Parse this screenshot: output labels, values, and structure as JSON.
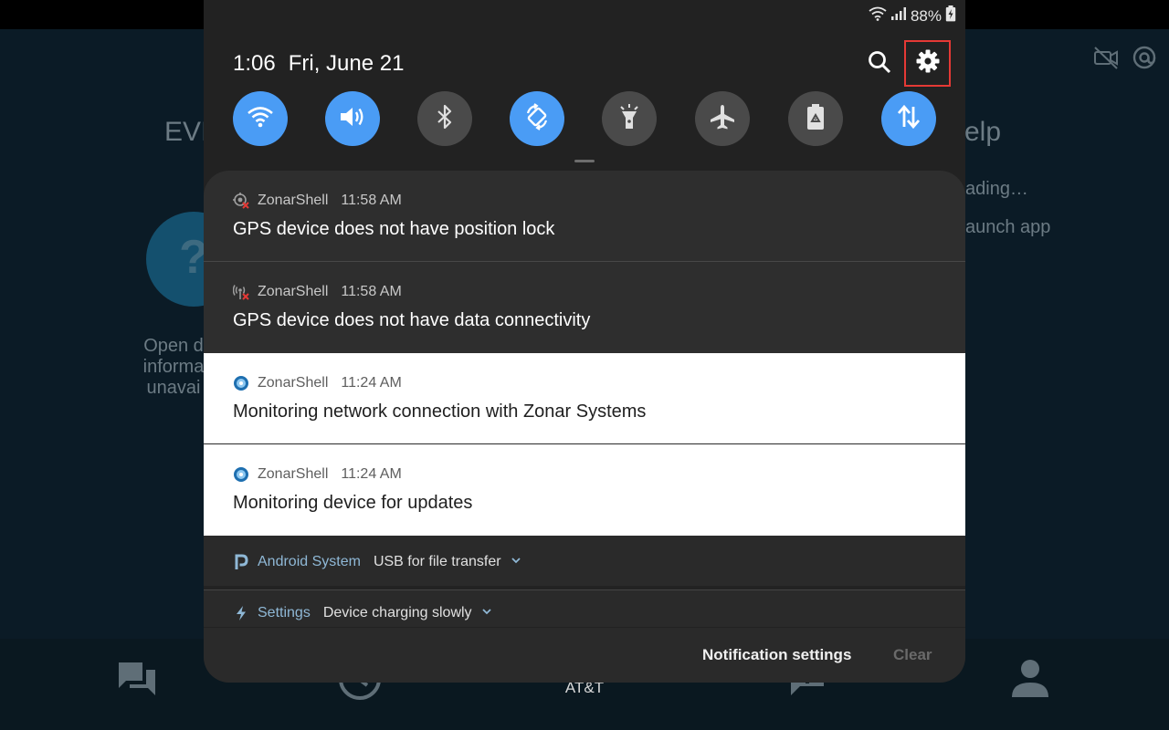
{
  "background_app": {
    "left_title": "EVI",
    "right_title": "elp",
    "right_line1": "ading…",
    "right_line2": "aunch app",
    "left_text": "Open d informa unavai",
    "help_glyph": "?",
    "carrier": "AT&T",
    "top_icons": [
      "camera-off-icon",
      "at-sign-icon"
    ],
    "nav_icons": [
      "chat-icon",
      "clock-icon",
      "alert-icon",
      "person-icon"
    ]
  },
  "status_bar": {
    "battery": "88%",
    "icons": [
      "wifi-icon",
      "signal-icon",
      "battery-charging-icon"
    ]
  },
  "header": {
    "time": "1:06",
    "date": "Fri, June 21"
  },
  "quick_settings": [
    {
      "name": "wifi",
      "on": true
    },
    {
      "name": "sound",
      "on": true
    },
    {
      "name": "bluetooth",
      "on": false
    },
    {
      "name": "auto-rotate",
      "on": true
    },
    {
      "name": "flashlight",
      "on": false
    },
    {
      "name": "airplane-mode",
      "on": false
    },
    {
      "name": "power-saving",
      "on": false
    },
    {
      "name": "mobile-data",
      "on": true
    }
  ],
  "notifications": [
    {
      "app": "ZonarShell",
      "time": "11:58 AM",
      "message": "GPS device does not have position lock",
      "icon": "gps-error-icon",
      "theme": "dark"
    },
    {
      "app": "ZonarShell",
      "time": "11:58 AM",
      "message": "GPS device does not have data connectivity",
      "icon": "antenna-error-icon",
      "theme": "dark"
    },
    {
      "app": "ZonarShell",
      "time": "11:24 AM",
      "message": "Monitoring network connection with Zonar Systems",
      "icon": "zonar-globe-icon",
      "theme": "light"
    },
    {
      "app": "ZonarShell",
      "time": "11:24 AM",
      "message": "Monitoring device for updates",
      "icon": "zonar-globe-icon",
      "theme": "light"
    }
  ],
  "system_notifications": [
    {
      "app": "Android System",
      "text": "USB for file transfer",
      "icon": "android-p-icon"
    },
    {
      "app": "Settings",
      "text": "Device charging slowly",
      "icon": "bolt-icon"
    }
  ],
  "footer": {
    "notification_settings": "Notification settings",
    "clear": "Clear"
  },
  "colors": {
    "accent": "#4a9cf5",
    "highlight_box": "#e53935",
    "shade_bg": "#222222"
  }
}
